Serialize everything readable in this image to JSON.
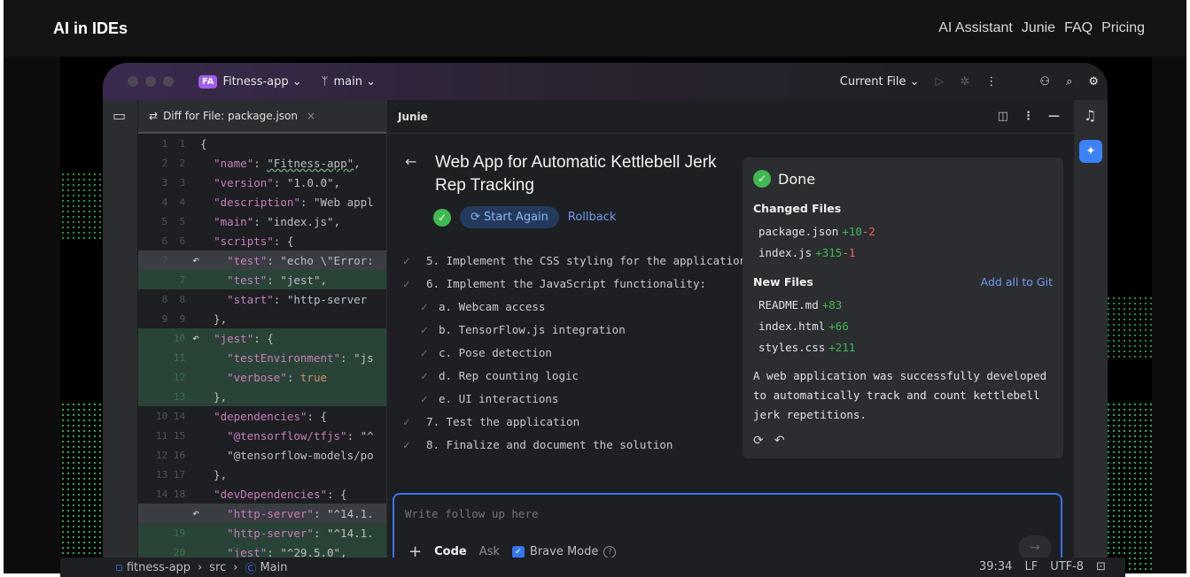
{
  "site": {
    "title": "AI in IDEs",
    "nav": [
      "AI Assistant",
      "Junie",
      "FAQ",
      "Pricing"
    ]
  },
  "ide": {
    "project_badge": "FA",
    "project_name": "Fitness-app ⌄",
    "branch": "main ⌄",
    "run_config": "Current File ⌄",
    "editor_tab": "Diff for File: package.json",
    "code_lines": [
      {
        "l": "1",
        "r": "1",
        "kind": "normal",
        "text": "{"
      },
      {
        "l": "2",
        "r": "2",
        "kind": "normal",
        "text": "  \"name\": \"Fitness-app\","
      },
      {
        "l": "3",
        "r": "3",
        "kind": "normal",
        "text": "  \"version\": \"1.0.0\","
      },
      {
        "l": "4",
        "r": "4",
        "kind": "normal",
        "text": "  \"description\": \"Web appl"
      },
      {
        "l": "5",
        "r": "5",
        "kind": "normal",
        "text": "  \"main\": \"index.js\","
      },
      {
        "l": "6",
        "r": "6",
        "kind": "normal",
        "text": "  \"scripts\": {"
      },
      {
        "l": "7",
        "r": "",
        "kind": "mod",
        "text": "    \"test\": \"echo \\\"Error:"
      },
      {
        "l": "",
        "r": "7",
        "kind": "add",
        "text": "    \"test\": \"jest\","
      },
      {
        "l": "8",
        "r": "8",
        "kind": "normal",
        "text": "    \"start\": \"http-server"
      },
      {
        "l": "9",
        "r": "9",
        "kind": "normal",
        "text": "  },"
      },
      {
        "l": "",
        "r": "10",
        "kind": "add",
        "text": "  \"jest\": {"
      },
      {
        "l": "",
        "r": "11",
        "kind": "add",
        "text": "    \"testEnvironment\": \"js"
      },
      {
        "l": "",
        "r": "12",
        "kind": "add",
        "text": "    \"verbose\": true"
      },
      {
        "l": "",
        "r": "13",
        "kind": "add",
        "text": "  },"
      },
      {
        "l": "10",
        "r": "14",
        "kind": "normal",
        "text": "  \"dependencies\": {"
      },
      {
        "l": "11",
        "r": "15",
        "kind": "normal",
        "text": "    \"@tensorflow/tfjs\": \"^"
      },
      {
        "l": "12",
        "r": "16",
        "kind": "normal",
        "text": "    \"@tensorflow-models/po"
      },
      {
        "l": "13",
        "r": "17",
        "kind": "normal",
        "text": "  },"
      },
      {
        "l": "14",
        "r": "18",
        "kind": "normal",
        "text": "  \"devDependencies\": {"
      },
      {
        "l": "",
        "r": "",
        "kind": "mod",
        "text": "    \"http-server\": \"^14.1."
      },
      {
        "l": "",
        "r": "19",
        "kind": "add",
        "text": "    \"http-server\": \"^14.1."
      },
      {
        "l": "",
        "r": "20",
        "kind": "add",
        "text": "    \"jest\": \"^29.5.0\","
      }
    ]
  },
  "junie": {
    "header": "Junie",
    "task_title": "Web App for Automatic Kettlebell Jerk Rep Tracking",
    "start_again": "Start Again",
    "rollback": "Rollback",
    "steps": [
      {
        "text": "5. Implement the CSS styling for the application",
        "sub": false
      },
      {
        "text": "6. Implement the JavaScript functionality:",
        "sub": false
      },
      {
        "text": "a. Webcam access",
        "sub": true
      },
      {
        "text": "b. TensorFlow.js integration",
        "sub": true
      },
      {
        "text": "c. Pose detection",
        "sub": true
      },
      {
        "text": "d. Rep counting logic",
        "sub": true
      },
      {
        "text": "e. UI interactions",
        "sub": true
      },
      {
        "text": "7. Test the application",
        "sub": false
      },
      {
        "text": "8. Finalize and document the solution",
        "sub": false
      }
    ],
    "summary": {
      "status": "Done",
      "changed_heading": "Changed Files",
      "changed_files": [
        {
          "name": "package.json",
          "plus": "+10",
          "minus": "-2"
        },
        {
          "name": "index.js",
          "plus": "+315",
          "minus": "-1"
        }
      ],
      "new_heading": "New Files",
      "add_all": "Add all to Git",
      "new_files": [
        {
          "name": "README.md",
          "plus": "+83"
        },
        {
          "name": "index.html",
          "plus": "+66"
        },
        {
          "name": "styles.css",
          "plus": "+211"
        }
      ],
      "description": "A web application was successfully developed to automatically track and count kettlebell jerk repetitions."
    },
    "followup": {
      "placeholder": "Write follow up here",
      "code": "Code",
      "ask": "Ask",
      "brave": "Brave Mode"
    }
  },
  "statusbar": {
    "path": [
      "fitness-app",
      "src",
      "Main"
    ],
    "position": "39:34",
    "line_ending": "LF",
    "encoding": "UTF-8"
  }
}
